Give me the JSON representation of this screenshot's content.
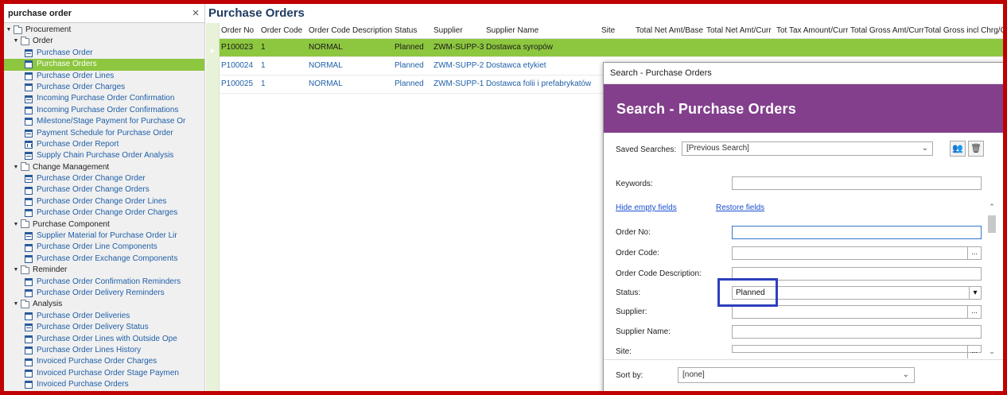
{
  "nav": {
    "search_value": "purchase order",
    "clear_icon": "×",
    "tree": [
      {
        "label": "Procurement",
        "level": 0,
        "type": "folder"
      },
      {
        "label": "Order",
        "level": 1,
        "type": "folder"
      },
      {
        "label": "Purchase Order",
        "level": 2,
        "type": "item",
        "icon": "doc-list-icon"
      },
      {
        "label": "Purchase Orders",
        "level": 2,
        "type": "item",
        "icon": "doc-icon",
        "selected": true
      },
      {
        "label": "Purchase Order Lines",
        "level": 2,
        "type": "item",
        "icon": "doc-icon"
      },
      {
        "label": "Purchase Order Charges",
        "level": 2,
        "type": "item",
        "icon": "doc-icon"
      },
      {
        "label": "Incoming Purchase Order Confirmation",
        "level": 2,
        "type": "item",
        "icon": "doc-list-icon"
      },
      {
        "label": "Incoming Purchase Order Confirmations",
        "level": 2,
        "type": "item",
        "icon": "doc-icon"
      },
      {
        "label": "Milestone/Stage Payment for Purchase Or",
        "level": 2,
        "type": "item",
        "icon": "doc-icon"
      },
      {
        "label": "Payment Schedule for Purchase Order",
        "level": 2,
        "type": "item",
        "icon": "doc-list-icon"
      },
      {
        "label": "Purchase Order Report",
        "level": 2,
        "type": "item",
        "icon": "report-icon"
      },
      {
        "label": "Supply Chain Purchase Order Analysis",
        "level": 2,
        "type": "item",
        "icon": "doc-list-icon"
      },
      {
        "label": "Change Management",
        "level": 1,
        "type": "folder"
      },
      {
        "label": "Purchase Order Change Order",
        "level": 2,
        "type": "item",
        "icon": "doc-list-icon"
      },
      {
        "label": "Purchase Order Change Orders",
        "level": 2,
        "type": "item",
        "icon": "doc-icon"
      },
      {
        "label": "Purchase Order Change Order Lines",
        "level": 2,
        "type": "item",
        "icon": "doc-icon"
      },
      {
        "label": "Purchase Order Change Order Charges",
        "level": 2,
        "type": "item",
        "icon": "doc-icon"
      },
      {
        "label": "Purchase Component",
        "level": 1,
        "type": "folder"
      },
      {
        "label": "Supplier Material for Purchase Order Lir",
        "level": 2,
        "type": "item",
        "icon": "doc-list-icon"
      },
      {
        "label": "Purchase Order Line Components",
        "level": 2,
        "type": "item",
        "icon": "doc-icon"
      },
      {
        "label": "Purchase Order Exchange Components",
        "level": 2,
        "type": "item",
        "icon": "doc-icon"
      },
      {
        "label": "Reminder",
        "level": 1,
        "type": "folder"
      },
      {
        "label": "Purchase Order Confirmation Reminders",
        "level": 2,
        "type": "item",
        "icon": "doc-icon"
      },
      {
        "label": "Purchase Order Delivery Reminders",
        "level": 2,
        "type": "item",
        "icon": "doc-icon"
      },
      {
        "label": "Analysis",
        "level": 1,
        "type": "folder"
      },
      {
        "label": "Purchase Order Deliveries",
        "level": 2,
        "type": "item",
        "icon": "doc-icon"
      },
      {
        "label": "Purchase Order Delivery Status",
        "level": 2,
        "type": "item",
        "icon": "doc-list-icon"
      },
      {
        "label": "Purchase Order Lines with Outside Ope",
        "level": 2,
        "type": "item",
        "icon": "doc-icon"
      },
      {
        "label": "Purchase Order Lines History",
        "level": 2,
        "type": "item",
        "icon": "doc-icon"
      },
      {
        "label": "Invoiced Purchase Order Charges",
        "level": 2,
        "type": "item",
        "icon": "doc-icon"
      },
      {
        "label": "Invoiced Purchase Order Stage Paymen",
        "level": 2,
        "type": "item",
        "icon": "doc-icon"
      },
      {
        "label": "Invoiced Purchase Orders",
        "level": 2,
        "type": "item",
        "icon": "doc-icon"
      }
    ]
  },
  "main": {
    "title": "Purchase Orders",
    "columns": [
      "Order No",
      "Order Code",
      "Order Code Description",
      "Status",
      "Supplier",
      "Supplier Name",
      "Site",
      "Total Net Amt/Base",
      "Total Net Amt/Curr",
      "Tot Tax Amount/Curr",
      "Total Gross Amt/Curr",
      "Total Gross incl Chrg/Cur"
    ],
    "rows": [
      {
        "order_no": "P100023",
        "order_code": "1",
        "desc": "NORMAL",
        "status": "Planned",
        "supplier": "ZWM-SUPP-3",
        "supplier_name": "Dostawca syropów",
        "selected": true
      },
      {
        "order_no": "P100024",
        "order_code": "1",
        "desc": "NORMAL",
        "status": "Planned",
        "supplier": "ZWM-SUPP-2",
        "supplier_name": "Dostawca etykiet"
      },
      {
        "order_no": "P100025",
        "order_code": "1",
        "desc": "NORMAL",
        "status": "Planned",
        "supplier": "ZWM-SUPP-1",
        "supplier_name": "Dostawca folii i prefabrykatów"
      }
    ]
  },
  "dialog": {
    "title": "Search - Purchase Orders",
    "banner": "Search - Purchase Orders",
    "saved_searches_label": "Saved Searches:",
    "saved_searches_value": "[Previous Search]",
    "keywords_label": "Keywords:",
    "hide_empty_link": "Hide empty fields",
    "restore_link": "Restore fields",
    "fields": [
      {
        "label": "Order No:",
        "value": "",
        "kind": "text"
      },
      {
        "label": "Order Code:",
        "value": "",
        "kind": "lov"
      },
      {
        "label": "Order Code Description:",
        "value": "",
        "kind": "text"
      },
      {
        "label": "Status:",
        "value": "Planned",
        "kind": "dropdown"
      },
      {
        "label": "Supplier:",
        "value": "",
        "kind": "lov"
      },
      {
        "label": "Supplier Name:",
        "value": "",
        "kind": "text"
      },
      {
        "label": "Site:",
        "value": "",
        "kind": "lov"
      }
    ],
    "sort_label": "Sort by:",
    "sort_value": "[none]"
  },
  "colors": {
    "frame": "#c00000",
    "selection": "#8dc63f",
    "banner": "#833f8c",
    "highlight_box": "#2e3fbd",
    "link": "#1f5fa8"
  }
}
